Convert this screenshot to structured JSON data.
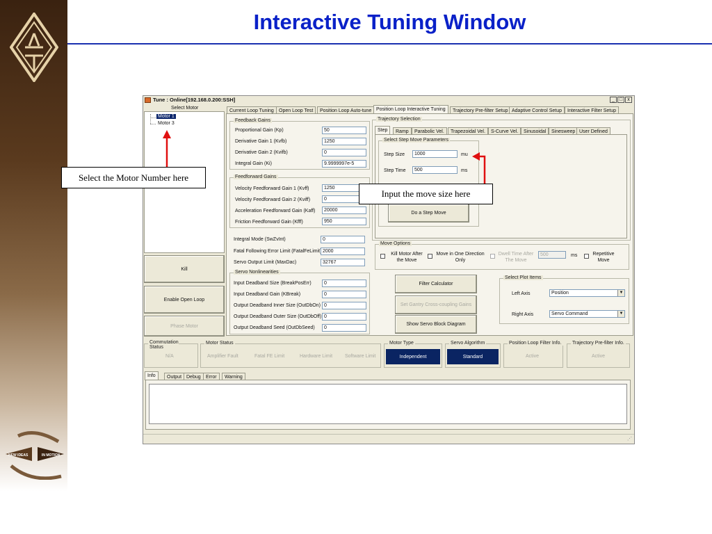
{
  "slide": {
    "title": "Interactive Tuning Window",
    "logo_text": "NEW IDEAS IN MOTION",
    "callout_motor": "Select the Motor Number here",
    "callout_move": "Input the move size here"
  },
  "window": {
    "title": "Tune : Online[192.168.0.200:SSH]",
    "minimize": "_",
    "maximize": "□",
    "close": "x"
  },
  "motor_list": {
    "header": "Select Motor",
    "items": [
      "Motor 1",
      "Motor 3"
    ]
  },
  "left_buttons": {
    "kill": "Kill",
    "enable_open_loop": "Enable Open Loop",
    "phase_motor": "Phase Motor"
  },
  "main_tabs": [
    "Current Loop Tuning",
    "Open Loop Test",
    "Position Loop Auto-tune",
    "Position Loop Interactive Tuning",
    "Trajectory Pre-filter Setup",
    "Adaptive Control Setup",
    "Interactive Filter Setup"
  ],
  "feedback_gains": {
    "title": "Feedback Gains",
    "kp_label": "Proportional Gain (Kp)",
    "kp": "50",
    "kvfb_label": "Derivative Gain 1 (Kvfb)",
    "kvfb": "1250",
    "kvfb2_label": "Derivative Gain 2 (Kvifb)",
    "kvfb2": "0",
    "ki_label": "Integral Gain (Ki)",
    "ki": "9.9999997e-5"
  },
  "feedforward_gains": {
    "title": "Feedforward Gains",
    "kvff_label": "Velocity Feedforward Gain 1 (Kvff)",
    "kvff": "1250",
    "kvff2_label": "Velocity Feedforward Gain 2 (Kviff)",
    "kvff2": "0",
    "kaff_label": "Acceleration Feedforward Gain (Kaff)",
    "kaff": "20000",
    "kfff_label": "Friction Feedforward Gain (Kfff)",
    "kfff": "950"
  },
  "misc": {
    "integral_mode_label": "Integral Mode (SwZvInt)",
    "integral_mode": "0",
    "fatal_fe_label": "Fatal Following Error Limit (FatalFeLimit)",
    "fatal_fe": "2000",
    "servo_limit_label": "Servo Output Limit (MaxDac)",
    "servo_limit": "32767"
  },
  "nonlinearities": {
    "title": "Servo Nonlinearities",
    "deadband_size_label": "Input Deadband Size (BreakPosErr)",
    "deadband_size": "0",
    "deadband_gain_label": "Input Deadband Gain (KBreak)",
    "deadband_gain": "0",
    "out_inner_label": "Output Deadband Inner Size (OutDbOn)",
    "out_inner": "0",
    "out_outer_label": "Output Deadband Outer Size (OutDbOff)",
    "out_outer": "0",
    "out_seed_label": "Output Deadband Seed (OutDbSeed)",
    "out_seed": "0"
  },
  "trajectory": {
    "title": "Trajectory Selection",
    "tabs": [
      "Step",
      "Ramp",
      "Parabolic Vel.",
      "Trapezoidal Vel.",
      "S-Curve Vel.",
      "Sinusoidal",
      "Sinesweep",
      "User Defined"
    ],
    "step_params_title": "Select Step Move Parameters",
    "step_size_label": "Step Size",
    "step_size": "1000",
    "step_size_unit": "mu",
    "step_time_label": "Step Time",
    "step_time": "500",
    "step_time_unit": "ms",
    "do_step": "Do a Step Move"
  },
  "move_options": {
    "title": "Move Options",
    "kill_motor": "Kill Motor After the Move",
    "one_direction": "Move in One Direction Only",
    "dwell_time": "Dwell Time After The Move",
    "dwell_value": "500",
    "dwell_unit": "ms",
    "repetitive": "Repetitive Move"
  },
  "tools": {
    "filter_calc": "Filter Calculator",
    "gantry": "Set Gantry Cross-coupling Gains",
    "block_diagram": "Show Servo Block Diagram"
  },
  "plot_items": {
    "title": "Select Plot Items",
    "left_label": "Left Axis",
    "left_value": "Position",
    "right_label": "Right Axis",
    "right_value": "Servo Command"
  },
  "status": {
    "commutation_title": "Commutation Status",
    "commutation_value": "N/A",
    "motor_status_title": "Motor Status",
    "amp_fault": "Amplifier Fault",
    "fatal_fe": "Fatal FE Limit",
    "hw_limit": "Hardware Limit",
    "sw_limit": "Software Limit",
    "motor_type_title": "Motor Type",
    "motor_type_value": "Independent",
    "servo_algo_title": "Servo Algorithm",
    "servo_algo_value": "Standard",
    "pos_filter_title": "Position Loop Filter Info.",
    "pos_filter_value": "Active",
    "traj_filter_title": "Trajectory Pre-filter Info.",
    "traj_filter_value": "Active"
  },
  "bottom_tabs": [
    "Info",
    "Output",
    "Debug",
    "Error",
    "Warning"
  ],
  "colors": {
    "title_blue": "#0a21c8",
    "arrow_red": "#e01010",
    "status_blue": "#0a2462"
  }
}
